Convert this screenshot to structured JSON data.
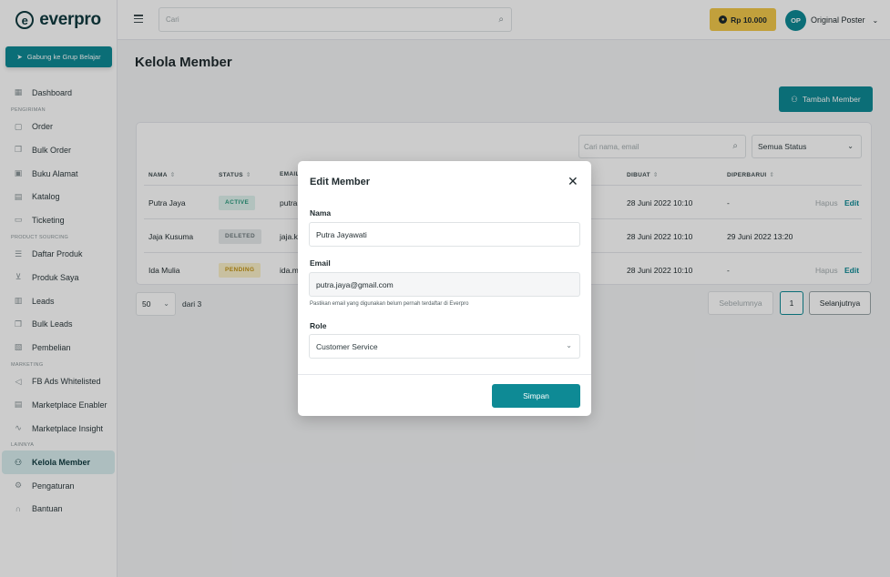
{
  "brand": {
    "logo_text": "everpro",
    "logo_mark": "e"
  },
  "sidebar": {
    "join_label": "Gabung ke Grup Belajar",
    "items": [
      {
        "type": "item",
        "label": "Dashboard",
        "icon": "grid-icon"
      },
      {
        "type": "section",
        "label": "PENGIRIMAN"
      },
      {
        "type": "item",
        "label": "Order",
        "icon": "box-icon"
      },
      {
        "type": "item",
        "label": "Bulk Order",
        "icon": "boxes-icon"
      },
      {
        "type": "item",
        "label": "Buku Alamat",
        "icon": "address-book-icon"
      },
      {
        "type": "item",
        "label": "Katalog",
        "icon": "catalog-icon"
      },
      {
        "type": "item",
        "label": "Ticketing",
        "icon": "ticket-icon"
      },
      {
        "type": "section",
        "label": "PRODUCT SOURCING"
      },
      {
        "type": "item",
        "label": "Daftar Produk",
        "icon": "list-icon"
      },
      {
        "type": "item",
        "label": "Produk Saya",
        "icon": "cart-icon"
      },
      {
        "type": "item",
        "label": "Leads",
        "icon": "leads-icon"
      },
      {
        "type": "item",
        "label": "Bulk Leads",
        "icon": "bulk-leads-icon"
      },
      {
        "type": "item",
        "label": "Pembelian",
        "icon": "purchase-icon"
      },
      {
        "type": "section",
        "label": "MARKETING"
      },
      {
        "type": "item",
        "label": "FB Ads Whitelisted",
        "icon": "megaphone-icon"
      },
      {
        "type": "item",
        "label": "Marketplace Enabler",
        "icon": "store-icon"
      },
      {
        "type": "item",
        "label": "Marketplace Insight",
        "icon": "chart-line-icon"
      },
      {
        "type": "section",
        "label": "LAINNYA"
      },
      {
        "type": "item",
        "label": "Kelola Member",
        "icon": "users-icon",
        "active": true
      },
      {
        "type": "item",
        "label": "Pengaturan",
        "icon": "gear-icon"
      },
      {
        "type": "item",
        "label": "Bantuan",
        "icon": "headset-icon"
      }
    ]
  },
  "topbar": {
    "search_placeholder": "Cari",
    "balance": "Rp 10.000",
    "user_initials": "OP",
    "user_name": "Original Poster"
  },
  "main": {
    "title": "Kelola Member",
    "add_button": "Tambah Member",
    "filter_placeholder": "Cari nama, email",
    "status_filter": "Semua Status",
    "columns": [
      "NAMA",
      "STATUS",
      "EMAIL",
      "DIBUAT",
      "DIPERBARUI"
    ],
    "rows": [
      {
        "name": "Putra Jaya",
        "status": "ACTIVE",
        "status_key": "active",
        "email": "putra",
        "created": "28 Juni 2022 10:10",
        "updated": "-",
        "actions": [
          "Hapus",
          "Edit"
        ]
      },
      {
        "name": "Jaja Kusuma",
        "status": "DELETED",
        "status_key": "deleted",
        "email": "jaja.k",
        "created": "28 Juni 2022 10:10",
        "updated": "29 Juni 2022 13:20",
        "actions": []
      },
      {
        "name": "Ida Mulia",
        "status": "PENDING",
        "status_key": "pending",
        "email": "ida.m",
        "created": "28 Juni 2022 10:10",
        "updated": "-",
        "actions": [
          "Hapus",
          "Edit"
        ]
      }
    ],
    "pagination": {
      "per_page": "50",
      "total_label": "dari 3",
      "prev": "Sebelumnya",
      "page": "1",
      "next": "Selanjutnya"
    }
  },
  "modal": {
    "title": "Edit Member",
    "name_label": "Nama",
    "name_value": "Putra Jayawati",
    "email_label": "Email",
    "email_value": "putra.jaya@gmail.com",
    "email_hint": "Pastikan email yang digunakan belum pernah terdaftar di Everpro",
    "role_label": "Role",
    "role_value": "Customer Service",
    "save_label": "Simpan"
  },
  "colors": {
    "accent": "#0e8a95",
    "balance": "#f2c84b",
    "dark": "#0f3a3f"
  }
}
